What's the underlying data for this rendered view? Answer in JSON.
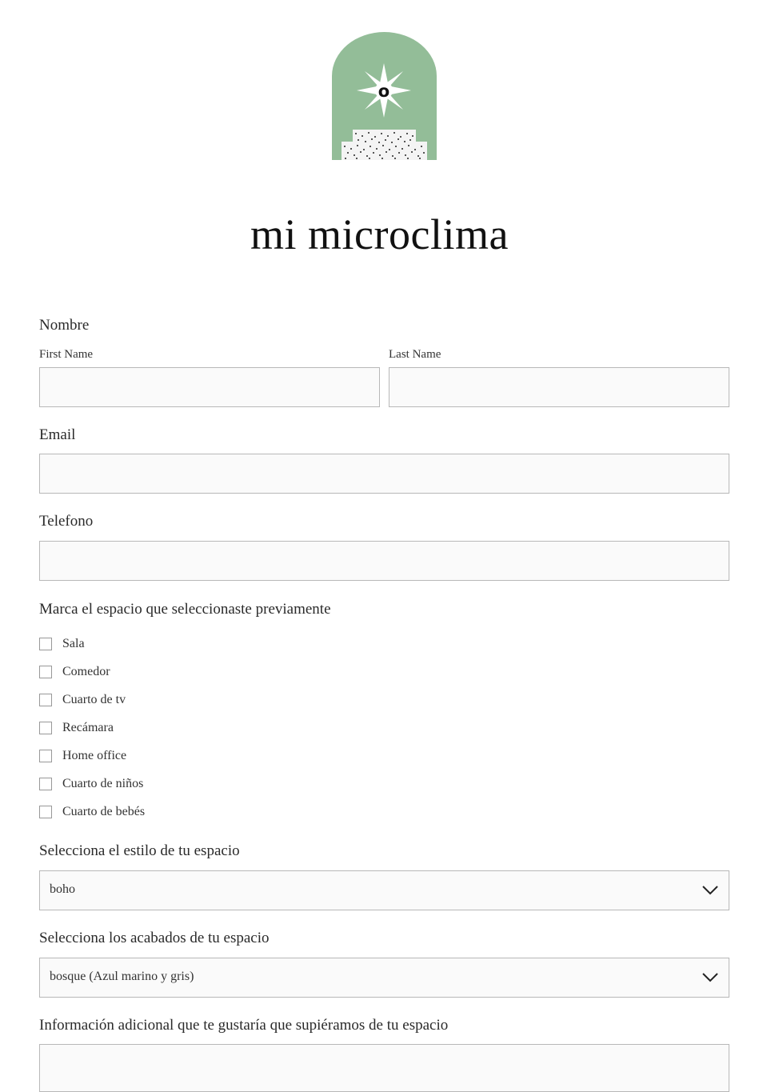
{
  "brand": {
    "title": "mi microclima",
    "logo_letter": "o"
  },
  "form": {
    "name_label": "Nombre",
    "first_name_label": "First Name",
    "first_name_value": "",
    "last_name_label": "Last Name",
    "last_name_value": "",
    "email_label": "Email",
    "email_value": "",
    "phone_label": "Telefono",
    "phone_value": "",
    "spaces_label": "Marca el espacio que seleccionaste previamente",
    "spaces": [
      {
        "label": "Sala",
        "checked": false
      },
      {
        "label": "Comedor",
        "checked": false
      },
      {
        "label": "Cuarto de tv",
        "checked": false
      },
      {
        "label": "Recámara",
        "checked": false
      },
      {
        "label": "Home office",
        "checked": false
      },
      {
        "label": "Cuarto de niños",
        "checked": false
      },
      {
        "label": "Cuarto de bebés",
        "checked": false
      }
    ],
    "style_label": "Selecciona el estilo de tu espacio",
    "style_value": "boho",
    "finish_label": "Selecciona los acabados de tu espacio",
    "finish_value": "bosque (Azul marino y gris)",
    "extra_label": "Información adicional que te gustaría que supiéramos de tu espacio",
    "extra_value": ""
  },
  "colors": {
    "logo_green": "#93bd98",
    "field_bg": "#fafafa",
    "border": "#b8b8b8"
  }
}
